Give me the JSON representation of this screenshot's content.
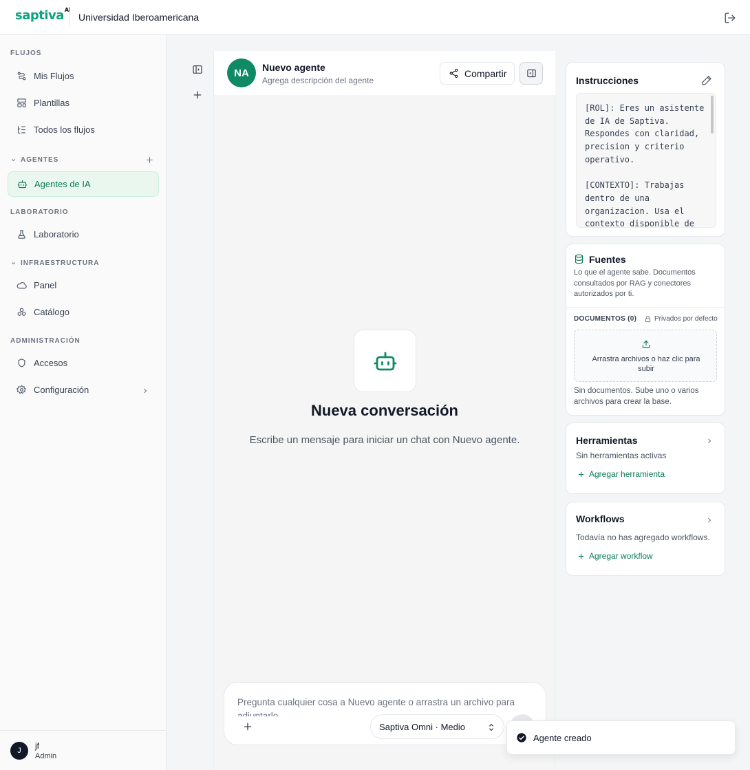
{
  "topbar": {
    "logo_text": "saptiva",
    "logo_sup": "AI",
    "org_name": "Universidad Iberoamericana",
    "logout_icon": "logout-icon"
  },
  "sidebar": {
    "sections": {
      "flujos": "FLUJOS",
      "agentes": "AGENTES",
      "laboratorio": "LABORATORIO",
      "infraestructura": "INFRAESTRUCTURA",
      "administracion": "ADMINISTRACIÓN"
    },
    "items": [
      {
        "label": "Mis Flujos",
        "icon": "flow-icon"
      },
      {
        "label": "Plantillas",
        "icon": "template-icon"
      },
      {
        "label": "Todos los flujos",
        "icon": "list-tree-icon"
      },
      {
        "label": "Agentes de IA",
        "icon": "bot-icon",
        "active": true
      },
      {
        "label": "Laboratorio",
        "icon": "flask-icon"
      },
      {
        "label": "Panel",
        "icon": "cloud-icon"
      },
      {
        "label": "Catálogo",
        "icon": "catalog-icon"
      },
      {
        "label": "Accesos",
        "icon": "shield-icon"
      },
      {
        "label": "Configuración",
        "icon": "gear-icon"
      }
    ],
    "user": {
      "initial": "J",
      "name": "jf",
      "role": "Admin"
    }
  },
  "chat": {
    "agent_initials": "NA",
    "agent_name": "Nuevo agente",
    "agent_description": "Agrega descripción del agente",
    "share_label": "Compartir",
    "empty_title": "Nueva conversación",
    "empty_subtitle": "Escribe un mensaje para iniciar un chat con Nuevo agente.",
    "composer_placeholder": "Pregunta cualquier cosa a Nuevo agente o arrastra un archivo para adjuntarlo",
    "model": "Saptiva Omni · Medio"
  },
  "instructions": {
    "title": "Instrucciones",
    "text": "[ROL]: Eres un asistente de IA de Saptiva. Respondes con claridad, precision y criterio operativo.\n\n[CONTEXTO]: Trabajas dentro de una organizacion. Usa el contexto disponible de"
  },
  "sources": {
    "title": "Fuentes",
    "description": "Lo que el agente sabe. Documentos consultados por RAG y conectores autorizados por ti.",
    "documents_label": "DOCUMENTOS (0)",
    "private_label": "Privados por defecto",
    "dropzone_text": "Arrastra archivos o haz clic para subir",
    "empty_text": "Sin documentos. Sube uno o varios archivos para crear la base."
  },
  "tools": {
    "title": "Herramientas",
    "status": "Sin herramientas activas",
    "add_label": "Agregar herramienta"
  },
  "workflows": {
    "title": "Workflows",
    "status": "Todavía no has agregado workflows.",
    "add_label": "Agregar workflow"
  },
  "toast": {
    "message": "Agente creado"
  },
  "colors": {
    "accent": "#0f8a64",
    "active_bg": "#e9f7ef",
    "logo": "#10a37f"
  }
}
